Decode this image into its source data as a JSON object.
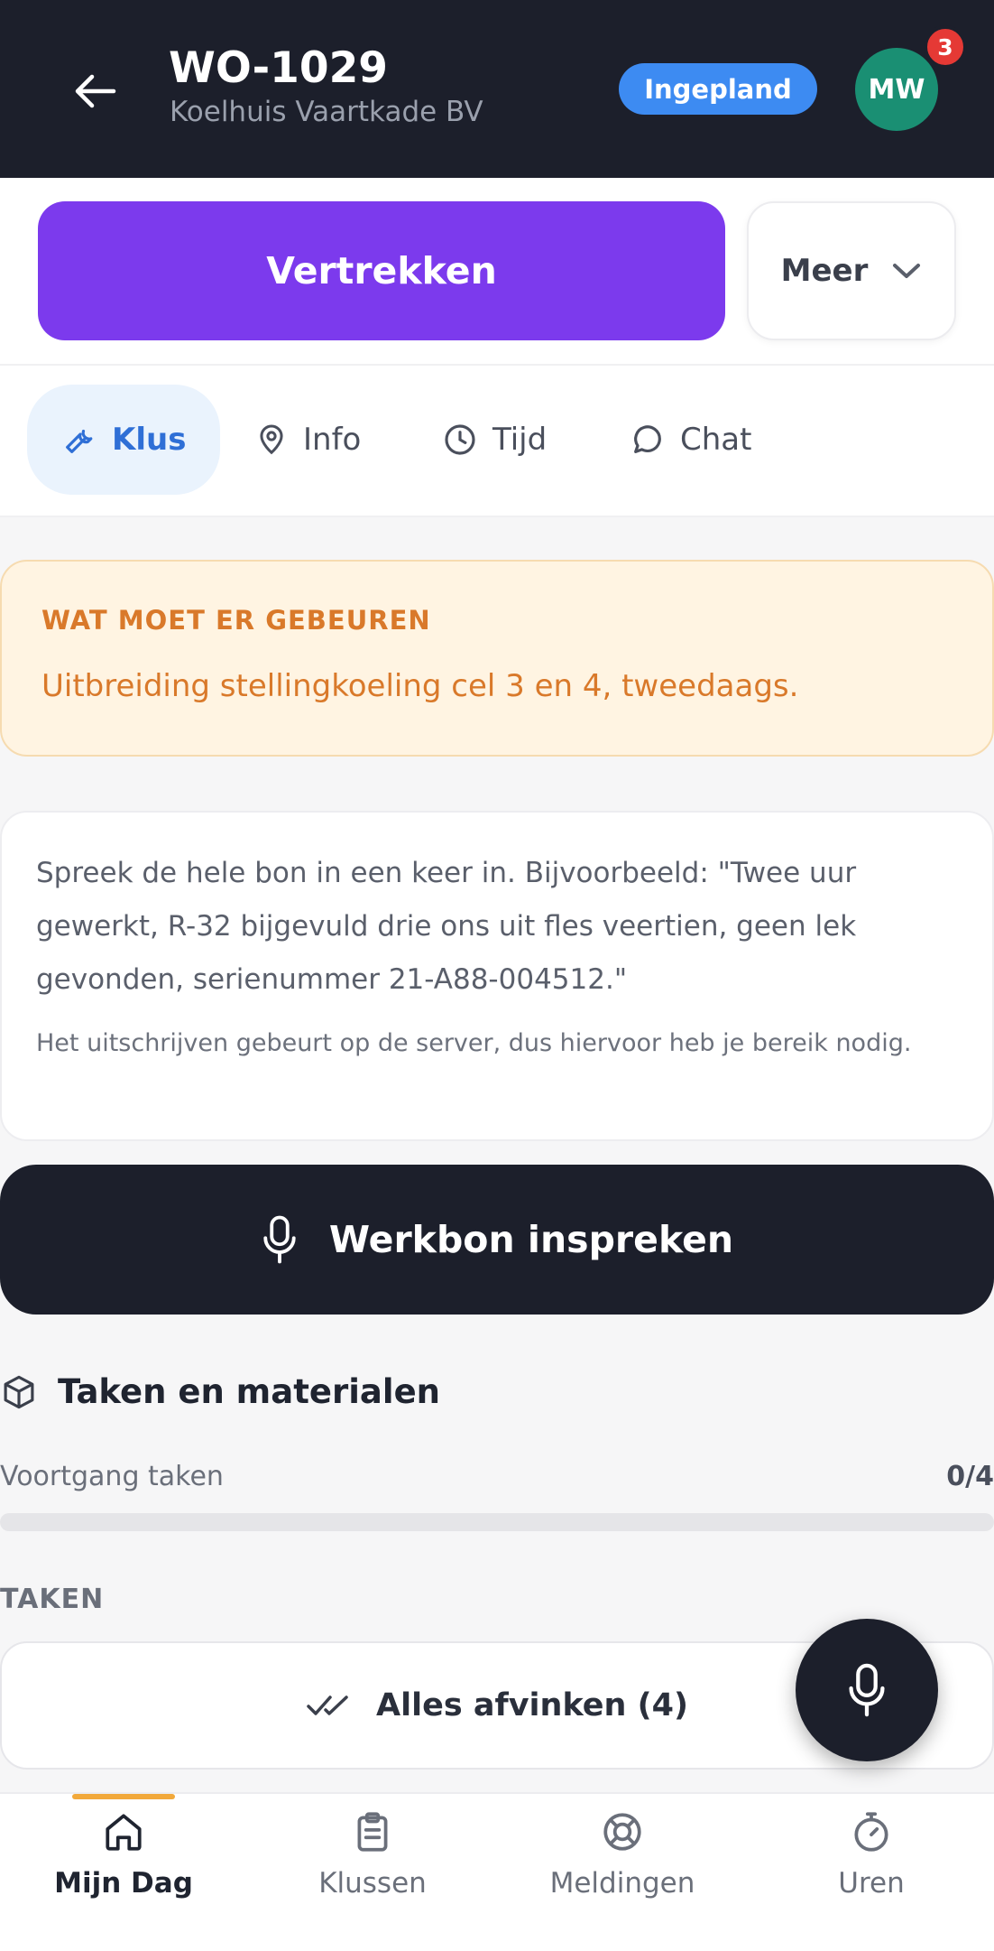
{
  "header": {
    "title": "WO-1029",
    "subtitle": "Koelhuis Vaartkade BV",
    "status": "Ingepland",
    "avatar_initials": "MW",
    "notification_count": "3"
  },
  "actions": {
    "primary_label": "Vertrekken",
    "more_label": "Meer"
  },
  "tabs": [
    {
      "label": "Klus",
      "icon": "wrench-icon",
      "active": true
    },
    {
      "label": "Info",
      "icon": "map-pin-icon",
      "active": false
    },
    {
      "label": "Tijd",
      "icon": "clock-icon",
      "active": false
    },
    {
      "label": "Chat",
      "icon": "chat-bubble-icon",
      "active": false
    }
  ],
  "alert": {
    "label": "WAT MOET ER GEBEUREN",
    "text": "Uitbreiding stellingkoeling cel 3 en 4, tweedaags."
  },
  "voice_info": {
    "text": "Spreek de hele bon in een keer in. Bijvoorbeeld: \"Twee uur gewerkt, R-32 bijgevuld drie ons uit fles veertien, geen lek gevonden, serienummer 21-A88-004512.\"",
    "note": "Het uitschrijven gebeurt op de server, dus hiervoor heb je bereik nodig."
  },
  "dictate_button": {
    "label": "Werkbon inspreken"
  },
  "tasks": {
    "section_title": "Taken en materialen",
    "progress_label": "Voortgang taken",
    "progress_value": "0/4",
    "progress_fraction": 0,
    "list_label": "TAKEN",
    "check_all_label": "Alles afvinken (4)"
  },
  "bottom_nav": [
    {
      "label": "Mijn Dag",
      "icon": "home-icon",
      "active": true
    },
    {
      "label": "Klussen",
      "icon": "clipboard-icon",
      "active": false
    },
    {
      "label": "Meldingen",
      "icon": "lifebuoy-icon",
      "active": false
    },
    {
      "label": "Uren",
      "icon": "stopwatch-icon",
      "active": false
    }
  ],
  "colors": {
    "header_bg": "#1c1f2b",
    "primary": "#7c3aed",
    "status_blue": "#3d8bf2",
    "avatar_green": "#1a8f73",
    "alert_orange": "#d9792a",
    "active_tab": "#2f6fd6",
    "nav_indicator": "#f2a93b"
  }
}
